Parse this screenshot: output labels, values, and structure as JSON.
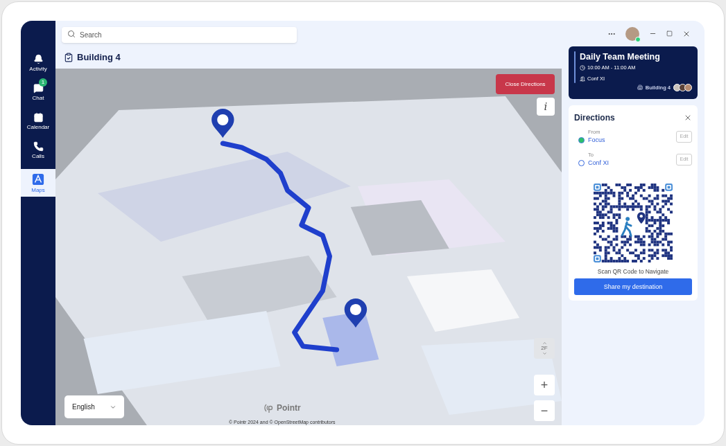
{
  "sidebar": {
    "items": [
      {
        "label": "Activity",
        "selected": false
      },
      {
        "label": "Chat",
        "selected": false,
        "badge": "1"
      },
      {
        "label": "Calendar",
        "selected": false
      },
      {
        "label": "Calls",
        "selected": false
      },
      {
        "label": "Maps",
        "selected": true
      }
    ]
  },
  "search": {
    "placeholder": "Search"
  },
  "page_title": "Building 4",
  "map": {
    "close_button": "Close Directions",
    "info_button": "i",
    "floor": "2F",
    "zoom_in": "+",
    "zoom_out": "−",
    "language": "English",
    "logo": "Pointr",
    "attribution": "© Pointr 2024 and © OpenStreetMap contributors"
  },
  "meeting": {
    "title": "Daily Team Meeting",
    "time": "10:00 AM - 11:00 AM",
    "room": "Conf XI",
    "building": "Building 4"
  },
  "directions": {
    "title": "Directions",
    "stops": [
      {
        "kind": "from",
        "label": "From",
        "place": "Focus",
        "edit": "Edit"
      },
      {
        "kind": "to",
        "label": "To",
        "place": "Conf XI",
        "edit": "Edit"
      }
    ],
    "qr_caption": "Scan QR Code to Navigate",
    "share_button": "Share my destination"
  }
}
